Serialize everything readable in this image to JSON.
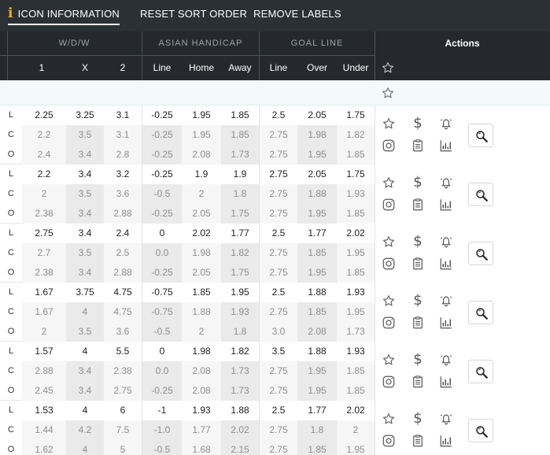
{
  "toolbar": {
    "icon_info": "ICON INFORMATION",
    "reset_sort": "RESET SORT ORDER",
    "remove_labels": "REMOVE LABELS"
  },
  "header": {
    "groups": {
      "wdw": "W/D/W",
      "asian_handicap": "ASIAN HANDICAP",
      "goal_line": "GOAL LINE"
    },
    "actions": "Actions",
    "columns": [
      "1",
      "X",
      "2",
      "Line",
      "Home",
      "Away",
      "Line",
      "Over",
      "Under"
    ]
  },
  "row_labels": {
    "live": "L",
    "closing": "C",
    "opening": "O"
  },
  "icons": {
    "favorite": "star-icon",
    "odds": "dollar-icon",
    "alert": "bell-icon",
    "social": "instagram-icon",
    "notes": "clipboard-icon",
    "stats": "bar-chart-icon",
    "details": "magnifier-icon"
  },
  "colors": {
    "header_bg": "#25292d",
    "toolbar_bg": "#2b3035",
    "accent": "#f2b11b"
  },
  "matches": [
    {
      "rows": [
        [
          "2.25",
          "3.25",
          "3.1",
          "-0.25",
          "1.95",
          "1.85",
          "2.5",
          "2.05",
          "1.75"
        ],
        [
          "2.2",
          "3.5",
          "3.1",
          "-0.25",
          "1.95",
          "1.85",
          "2.75",
          "1.98",
          "1.82"
        ],
        [
          "2.4",
          "3.4",
          "2.8",
          "-0.25",
          "2.08",
          "1.73",
          "2.75",
          "1.95",
          "1.85"
        ]
      ]
    },
    {
      "rows": [
        [
          "2.2",
          "3.4",
          "3.2",
          "-0.25",
          "1.9",
          "1.9",
          "2.75",
          "2.05",
          "1.75"
        ],
        [
          "2",
          "3.5",
          "3.6",
          "-0.5",
          "2",
          "1.8",
          "2.75",
          "1.88",
          "1.93"
        ],
        [
          "2.38",
          "3.4",
          "2.88",
          "-0.25",
          "2.05",
          "1.75",
          "2.75",
          "1.95",
          "1.85"
        ]
      ]
    },
    {
      "rows": [
        [
          "2.75",
          "3.4",
          "2.4",
          "0",
          "2.02",
          "1.77",
          "2.5",
          "1.77",
          "2.02"
        ],
        [
          "2.7",
          "3.5",
          "2.5",
          "0.0",
          "1.98",
          "1.82",
          "2.75",
          "1.85",
          "1.95"
        ],
        [
          "2.38",
          "3.4",
          "2.88",
          "-0.25",
          "2.05",
          "1.75",
          "2.75",
          "1.95",
          "1.85"
        ]
      ]
    },
    {
      "rows": [
        [
          "1.67",
          "3.75",
          "4.75",
          "-0.75",
          "1.85",
          "1.95",
          "2.5",
          "1.88",
          "1.93"
        ],
        [
          "1.67",
          "4",
          "4.75",
          "-0.75",
          "1.88",
          "1.93",
          "2.75",
          "1.85",
          "1.95"
        ],
        [
          "2",
          "3.5",
          "3.6",
          "-0.5",
          "2",
          "1.8",
          "3.0",
          "2.08",
          "1.73"
        ]
      ]
    },
    {
      "rows": [
        [
          "1.57",
          "4",
          "5.5",
          "0",
          "1.98",
          "1.82",
          "3.5",
          "1.88",
          "1.93"
        ],
        [
          "2.88",
          "3.4",
          "2.38",
          "0.0",
          "2.08",
          "1.73",
          "2.75",
          "1.95",
          "1.85"
        ],
        [
          "2.45",
          "3.4",
          "2.75",
          "-0.25",
          "2.08",
          "1.73",
          "2.75",
          "1.95",
          "1.85"
        ]
      ]
    },
    {
      "rows": [
        [
          "1.53",
          "4",
          "6",
          "-1",
          "1.93",
          "1.88",
          "2.5",
          "1.77",
          "2.02"
        ],
        [
          "1.44",
          "4.2",
          "7.5",
          "-1.0",
          "1.77",
          "2.02",
          "2.75",
          "1.8",
          "2"
        ],
        [
          "1.62",
          "4",
          "5",
          "-0.5",
          "1.68",
          "2.15",
          "2.75",
          "1.85",
          "1.95"
        ]
      ]
    }
  ]
}
